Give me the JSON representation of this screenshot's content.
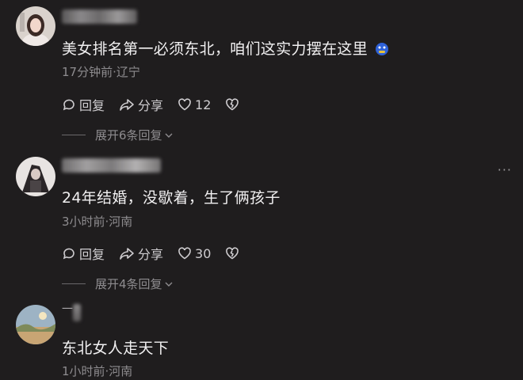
{
  "comments": [
    {
      "text": "美女排名第一必须东北，咱们这实力摆在这里",
      "meta": "17分钟前·辽宁",
      "reply_label": "回复",
      "share_label": "分享",
      "like_count": "12",
      "expand_label": "展开6条回复"
    },
    {
      "text": "24年结婚，没歇着，生了俩孩子",
      "meta": "3小时前·河南",
      "reply_label": "回复",
      "share_label": "分享",
      "like_count": "30",
      "expand_label": "展开4条回复",
      "more_icon": "more-dots-icon"
    },
    {
      "username": "一",
      "text": "东北女人走天下",
      "meta": "1小时前·河南"
    }
  ],
  "colors": {
    "background": "#1f1d1e",
    "text_primary": "#f1f0f1",
    "text_secondary": "#8e8c8f"
  },
  "icons": [
    "reply-icon",
    "share-icon",
    "heart-icon",
    "broken-heart-icon",
    "chevron-down-icon",
    "emoji-icon"
  ]
}
